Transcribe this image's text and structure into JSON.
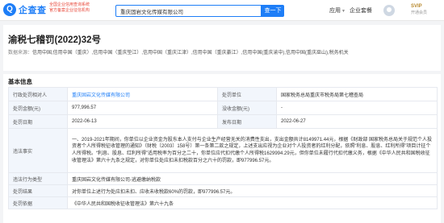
{
  "header": {
    "logo_mark": "Q",
    "logo_text": "企查查",
    "slogan": [
      "全国企业信用查询系统",
      "官方备案企业征信机构"
    ],
    "search_value": "重庆固岩文化传媒有限公司",
    "search_button": "查一下",
    "nav_app": "应用",
    "nav_enterprise": "企业套餐",
    "vip_label": "SVIP",
    "vip_sub": "开通会员"
  },
  "summary": {
    "title": "渝税七稽罚(2022)32号",
    "source_label": "数据来源：",
    "sources": "信用中国,信用中国（重庆）,信用中国（重庆垫江）,信用中国（重庆江津）,信用中国（重庆綦江）,信用中国(重庆渝中),信用中国(重庆巫山),税务机关"
  },
  "section_title": "基本信息",
  "table": {
    "rows": [
      [
        {
          "k": "行政处罚相对人",
          "v": "重庆固岩文化传媒有限公司",
          "link": true
        },
        {
          "k": "处罚单位",
          "v": "国家税务总局重庆市税务局第七稽查局"
        }
      ],
      [
        {
          "k": "处罚金额(元)",
          "v": "977,996.57"
        },
        {
          "k": "没收金额(元)",
          "v": "-"
        }
      ],
      [
        {
          "k": "处罚日期",
          "v": "2022-06-13"
        },
        {
          "k": "发布日期",
          "v": "2022-06-27"
        }
      ]
    ],
    "case_label": "违法事实",
    "case_text": "一、2019-2021年期间，你单位以企业资金为股东本人支付与企业生产经营无关的消费性支出，支出金额共计8149971.44元，根据《财政部 国家税务总局关于规范个人投资者个人所得税征收管理的通知》（财税〔2003〕158号）第一条第二款之规定，上述支出应视为企业对个人投资者的红利分配，依照“利息、股息、红利所得”项目计征个人所得税。“利息、股息、红利所得”适用税率为百分之二十，你单位应代扣代缴个人所得税1629994.29元，但你单位未履行代扣代缴义务，根据《中华人民共和国税收征收管理法》第六十九条之规定，对你单位处应扣未扣税款百分之六十的罚款，即977996.57元。",
    "basis_label": "违法行为类型",
    "basis_value": "重庆固岩文化传媒有限公司-逃避缴纳税款",
    "result_label": "处罚结果",
    "result_value": "对你单位上述行为处应扣未扣、应收未收税款60%的罚款，即977996.57元。",
    "law_label": "处罚依据",
    "law_value": "《中华人民共和国税收征收管理法》第六十九条"
  },
  "colors": {
    "brand": "#1e7ef7",
    "slogan": "#e8483a",
    "label_bg": "#f2f6fc",
    "border": "#e6e9ef"
  }
}
